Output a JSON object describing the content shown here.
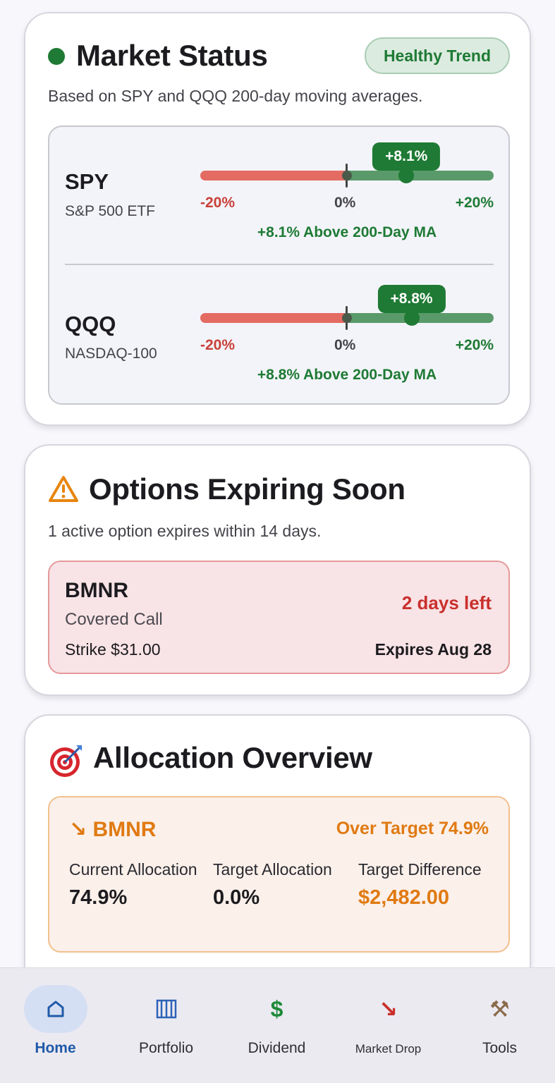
{
  "colors": {
    "healthy_green": "#1e7a34",
    "danger_red": "#c9302c",
    "warning_orange": "#e07a12",
    "nav_active": "#1f5aa8"
  },
  "market_status": {
    "title": "Market Status",
    "badge": "Healthy Trend",
    "subtitle": "Based on SPY and QQQ 200-day moving averages.",
    "scale": {
      "min_label": "-20%",
      "zero_label": "0%",
      "max_label": "+20%",
      "min": -20,
      "max": 20
    },
    "indices": [
      {
        "ticker": "SPY",
        "name": "S&P 500 ETF",
        "value": 8.1,
        "value_label": "+8.1%",
        "ma_text": "+8.1% Above 200-Day MA"
      },
      {
        "ticker": "QQQ",
        "name": "NASDAQ-100",
        "value": 8.8,
        "value_label": "+8.8%",
        "ma_text": "+8.8% Above 200-Day MA"
      }
    ]
  },
  "options": {
    "title": "Options Expiring Soon",
    "icon": "warning-icon",
    "subtitle": "1 active option expires within 14 days.",
    "items": [
      {
        "ticker": "BMNR",
        "type": "Covered Call",
        "strike": "Strike $31.00",
        "days_left": "2 days left",
        "expires": "Expires Aug 28"
      }
    ]
  },
  "allocation": {
    "title": "Allocation Overview",
    "icon": "target-icon",
    "items": [
      {
        "arrow": "↘",
        "ticker": "BMNR",
        "status": "Over Target 74.9%",
        "current_label": "Current Allocation",
        "current_value": "74.9%",
        "target_label": "Target Allocation",
        "target_value": "0.0%",
        "diff_label": "Target Difference",
        "diff_value": "$2,482.00"
      }
    ]
  },
  "nav": {
    "items": [
      {
        "label": "Home",
        "icon": "home-icon",
        "active": true
      },
      {
        "label": "Portfolio",
        "icon": "portfolio-icon",
        "active": false
      },
      {
        "label": "Dividend",
        "icon": "dollar-icon",
        "glyph": "$",
        "active": false
      },
      {
        "label": "Market Drop",
        "icon": "trend-down-icon",
        "glyph": "↘",
        "active": false
      },
      {
        "label": "Tools",
        "icon": "tools-icon",
        "glyph": "⚒",
        "active": false
      }
    ]
  }
}
